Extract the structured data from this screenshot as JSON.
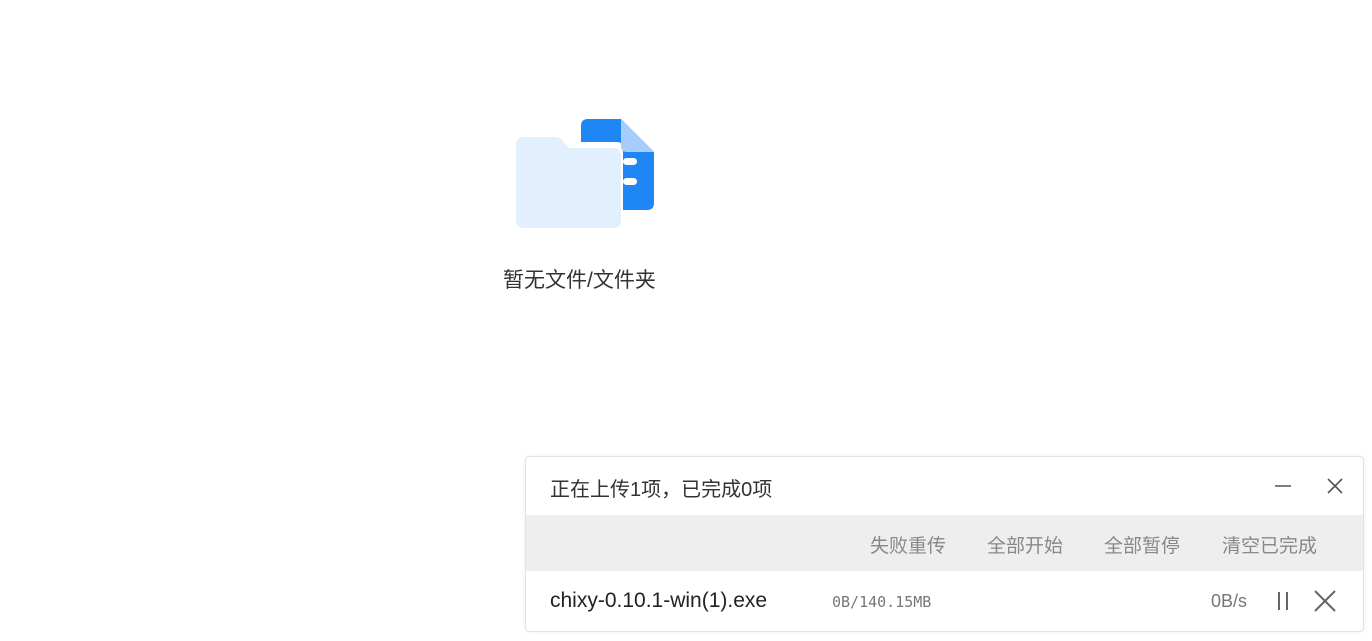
{
  "empty_state": {
    "illustration_icon": "empty-folder-document-icon",
    "message": "暂无文件/文件夹"
  },
  "upload_panel": {
    "title": "正在上传1项，已完成0项",
    "header_icons": {
      "minimize": "minimize-icon",
      "close": "close-icon"
    },
    "toolbar": {
      "retry_failed": "失败重传",
      "start_all": "全部开始",
      "pause_all": "全部暂停",
      "clear_completed": "清空已完成"
    },
    "items": [
      {
        "file_name": "chixy-0.10.1-win(1).exe",
        "progress": "0B/140.15MB",
        "speed": "0B/s",
        "pause_icon": "pause-icon",
        "remove_icon": "close-icon"
      }
    ]
  },
  "colors": {
    "accent_blue": "#1e86f5",
    "folder_light": "#e2effd",
    "toolbar_bg": "#eeeeee"
  }
}
